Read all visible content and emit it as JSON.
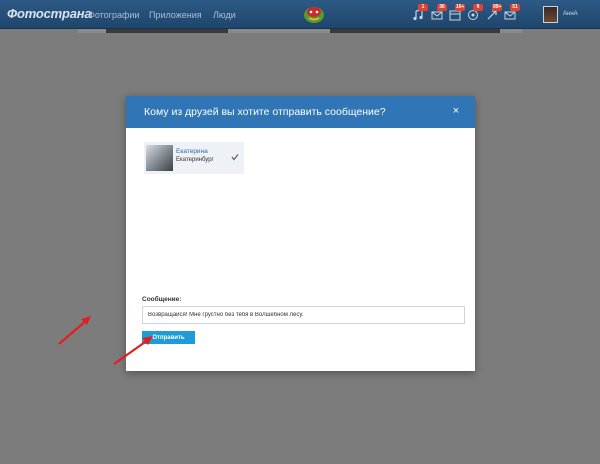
{
  "topbar": {
    "logo": "Фотострана",
    "nav": [
      "Фотографии",
      "Приложения",
      "Люди"
    ],
    "badges": [
      "1",
      "36",
      "16+",
      "9",
      "99+",
      "51"
    ],
    "username": "АннА"
  },
  "modal": {
    "title": "Кому из друзей вы хотите отправить сообщение?",
    "close": "×",
    "friend": {
      "name": "Екатерина",
      "city": "Екатеринбург"
    },
    "message_label": "Сообщение:",
    "message_value": "Возвращайся! Мне грустно без тебя в Волшебном лесу.",
    "send_label": "Отправить"
  },
  "colors": {
    "topbar": "#24507b",
    "modal_header": "#3076b7",
    "send_button": "#1f9bd7",
    "annotation_arrow": "#e02020"
  },
  "icons": [
    "music-icon",
    "mail-icon",
    "events-icon",
    "groups-icon",
    "gift-icon",
    "messages-icon",
    "check-icon",
    "close-icon"
  ]
}
